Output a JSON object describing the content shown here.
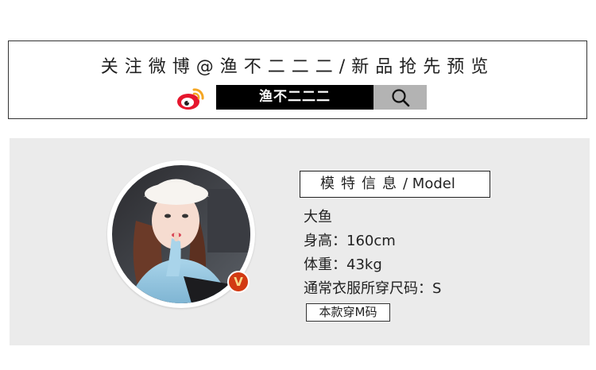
{
  "follow": {
    "title": "关注微博@渔不二二二/新品抢先预览",
    "search_value": "渔不二二二"
  },
  "model": {
    "header_cn": "模特信息",
    "header_en": "/ Model",
    "name": "大鱼",
    "height": "身高：160cm",
    "weight": "体重：43kg",
    "usual_size": "通常衣服所穿尺码：S",
    "size_note": "本款穿M码",
    "badge": "V"
  },
  "icons": {
    "logo": "weibo-logo-icon",
    "search": "search-icon",
    "verified": "verified-v-icon"
  },
  "colors": {
    "weibo_red": "#e6162d",
    "weibo_gold": "#f5a623",
    "panel_bg": "#ebebeb",
    "search_bg": "#000000",
    "search_btn_bg": "#b3b3b3",
    "badge_red": "#d23a13"
  }
}
